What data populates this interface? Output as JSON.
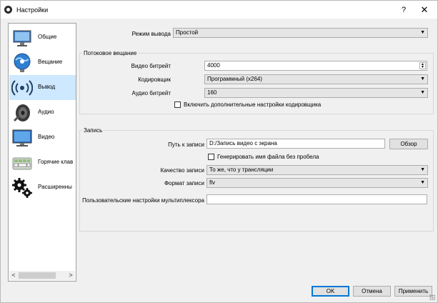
{
  "window": {
    "title": "Настройки",
    "help": "?",
    "close": "✕"
  },
  "sidebar": {
    "items": [
      {
        "label": "Общие",
        "icon": "monitor-general-icon",
        "active": false
      },
      {
        "label": "Вещание",
        "icon": "globe-broadcast-icon",
        "active": false
      },
      {
        "label": "Вывод",
        "icon": "broadcast-output-icon",
        "active": true
      },
      {
        "label": "Аудио",
        "icon": "speaker-icon",
        "active": false
      },
      {
        "label": "Видео",
        "icon": "display-icon",
        "active": false
      },
      {
        "label": "Горячие клав",
        "icon": "keyboard-icon",
        "active": false
      },
      {
        "label": "Расширенны",
        "icon": "gears-icon",
        "active": false
      }
    ],
    "scroll_left": "<",
    "scroll_right": ">"
  },
  "output": {
    "mode_label": "Режим вывода",
    "mode_value": "Простой",
    "streaming": {
      "title": "Потоковое вещание",
      "video_bitrate_label": "Видео битрейт",
      "video_bitrate_value": "4000",
      "encoder_label": "Кодировщик",
      "encoder_value": "Программный (x264)",
      "audio_bitrate_label": "Аудио битрейт",
      "audio_bitrate_value": "160",
      "advanced_encoder_label": "Включить дополнительные настройки кодировщика",
      "advanced_encoder_checked": false
    },
    "recording": {
      "title": "Запись",
      "path_label": "Путь к записи",
      "path_value": "D:/Запись видео с экрана",
      "browse_label": "Обзор",
      "no_space_label": "Генерировать имя файла без пробела",
      "no_space_checked": false,
      "quality_label": "Качество записи",
      "quality_value": "То же, что у трансляции",
      "format_label": "Формат записи",
      "format_value": "flv",
      "muxer_label": "Пользовательские настройки мультиплексора",
      "muxer_value": ""
    }
  },
  "buttons": {
    "ok": "OK",
    "cancel": "Отмена",
    "apply": "Применить"
  },
  "colors": {
    "active_item": "#cde8ff",
    "default_button_border": "#0078d7"
  }
}
